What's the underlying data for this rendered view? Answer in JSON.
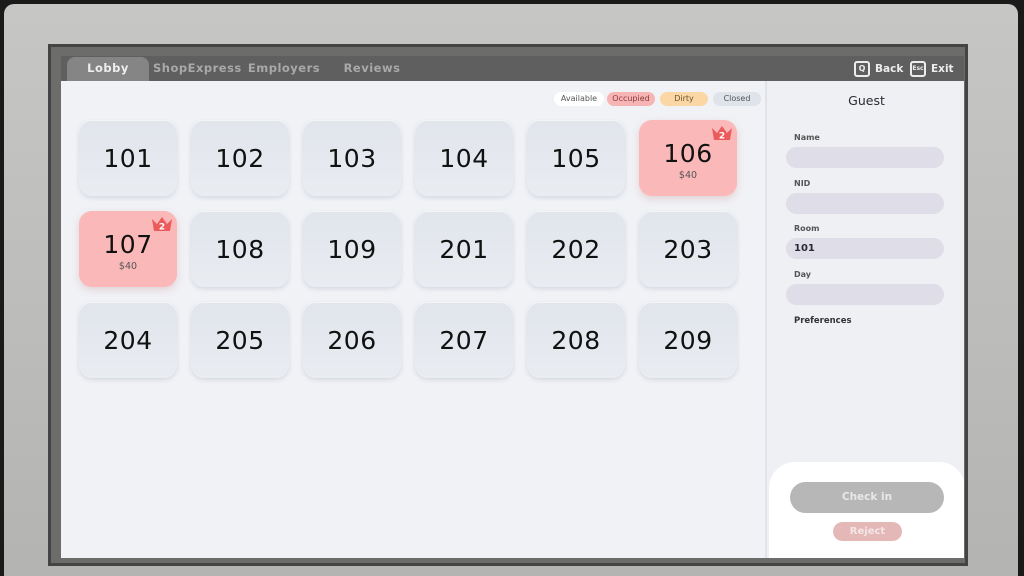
{
  "tabs": [
    {
      "label": "Lobby",
      "active": true
    },
    {
      "label": "ShopExpress",
      "active": false
    },
    {
      "label": "Employers",
      "active": false
    },
    {
      "label": "Reviews",
      "active": false
    }
  ],
  "shortcuts": {
    "back": {
      "key": "Q",
      "label": "Back"
    },
    "exit": {
      "key": "Esc",
      "label": "Exit"
    }
  },
  "legend": {
    "available": "Available",
    "occupied": "Occupied",
    "dirty": "Dirty",
    "closed": "Closed"
  },
  "colors": {
    "available": "#e3e7ee",
    "occupied": "#fbb8b8",
    "dirty": "#fbd7a6",
    "closed": "#dfe3ea",
    "crown": "#ec5b5b"
  },
  "rooms": [
    {
      "number": "101",
      "status": "available"
    },
    {
      "number": "102",
      "status": "available"
    },
    {
      "number": "103",
      "status": "available"
    },
    {
      "number": "104",
      "status": "available"
    },
    {
      "number": "105",
      "status": "available"
    },
    {
      "number": "106",
      "status": "occupied",
      "price": "$40",
      "stars": "2"
    },
    {
      "number": "107",
      "status": "occupied",
      "price": "$40",
      "stars": "2"
    },
    {
      "number": "108",
      "status": "available"
    },
    {
      "number": "109",
      "status": "available"
    },
    {
      "number": "201",
      "status": "available"
    },
    {
      "number": "202",
      "status": "available"
    },
    {
      "number": "203",
      "status": "available"
    },
    {
      "number": "204",
      "status": "available"
    },
    {
      "number": "205",
      "status": "available"
    },
    {
      "number": "206",
      "status": "available"
    },
    {
      "number": "207",
      "status": "available"
    },
    {
      "number": "208",
      "status": "available"
    },
    {
      "number": "209",
      "status": "available"
    }
  ],
  "guest": {
    "title": "Guest",
    "name_label": "Name",
    "name_value": "",
    "nid_label": "NID",
    "nid_value": "",
    "room_label": "Room",
    "room_value": "101",
    "day_label": "Day",
    "day_value": "",
    "preferences_label": "Preferences"
  },
  "actions": {
    "checkin": "Check in",
    "reject": "Reject"
  }
}
